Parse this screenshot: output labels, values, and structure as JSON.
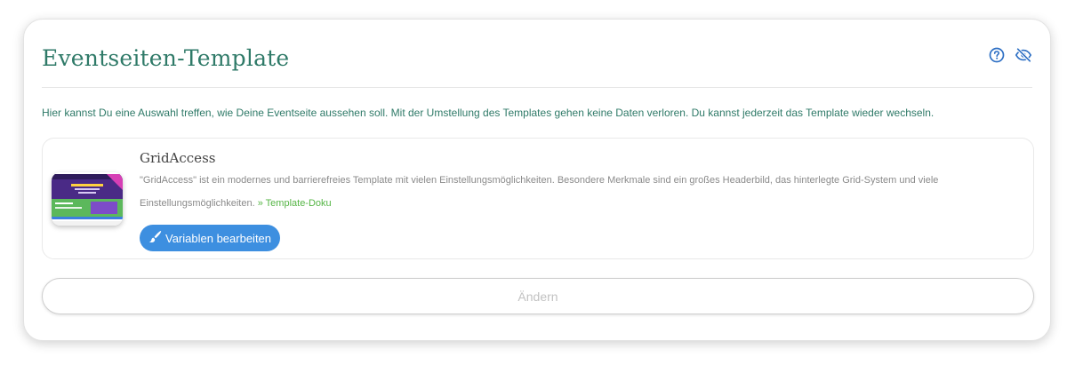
{
  "card": {
    "title": "Eventseiten-Template",
    "icons": {
      "help": "question-circle-icon",
      "visibility": "eye-slash-icon"
    },
    "intro": "Hier kannst Du eine Auswahl treffen, wie Deine Eventseite aussehen soll. Mit der Umstellung des Templates gehen keine Daten verloren. Du kannst jederzeit das Template wieder wechseln."
  },
  "template": {
    "name": "GridAccess",
    "description": "\"GridAccess\" ist ein modernes und barrierefreies Template mit vielen Einstellungsmöglichkeiten. Besondere Merkmale sind ein großes Headerbild, das hinterlegte Grid-System und viele Einstellungsmöglichkeiten.",
    "doc_link": "» Template-Doku",
    "edit_button_label": "Variablen bearbeiten",
    "edit_button_icon": "paintbrush-icon",
    "thumbnail_heading": "HINTERGRUND"
  },
  "actions": {
    "change_label": "Ändern"
  },
  "colors": {
    "accent": "#2f7a68",
    "link_green": "#55b545",
    "button_blue": "#3d8fe0",
    "icon_blue": "#2d6fc4",
    "thumb_purple": "#4a2a86",
    "thumb_green": "#5cb85c"
  }
}
